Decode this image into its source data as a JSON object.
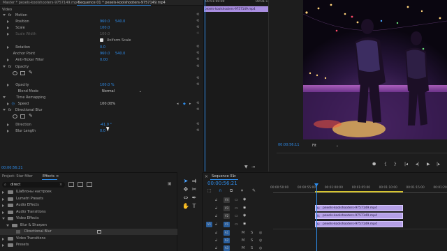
{
  "tabs": {
    "master": "Master * pexels-koolshooters-9757149.mp4",
    "sequence": "Sequence 01 * pexels-koolshooters-9757149.mp4"
  },
  "effect_controls": {
    "section": "Video",
    "motion": "Motion",
    "position_label": "Position",
    "position_x": "960.0",
    "position_y": "540.0",
    "scale_label": "Scale",
    "scale_value": "100.0",
    "scale_width_label": "Scale Width",
    "scale_width_value": "100.0",
    "uniform_scale": "Uniform Scale",
    "rotation_label": "Rotation",
    "rotation_value": "0.0",
    "anchor_label": "Anchor Point",
    "anchor_x": "960.0",
    "anchor_y": "540.0",
    "antiflicker_label": "Anti-flicker Filter",
    "antiflicker_value": "0.00",
    "opacity": "Opacity",
    "opacity_label": "Opacity",
    "opacity_value": "100.0 %",
    "blend_label": "Blend Mode",
    "blend_value": "Normal",
    "time_remap": "Time Remapping",
    "speed_label": "Speed",
    "speed_value": "100.00%",
    "directional_blur": "Directional Blur",
    "direction_label": "Direction",
    "direction_value": "-41.0 °",
    "blur_length_label": "Blur Length",
    "blur_length_value": "0.0",
    "timecode": "00:00:56:21"
  },
  "mini_timeline": {
    "start": "00:01:00:00",
    "end": "00:01:1",
    "clip": "pexels-koolshooters-9757149.mp4"
  },
  "monitor": {
    "timecode": "00:00:56:11",
    "fit": "Fit"
  },
  "project": {
    "tab_project": "Project: Star filter",
    "tab_effects": "Effects",
    "search_value": "direct",
    "items": [
      {
        "label": "Шаблоны настроек",
        "indent": 0
      },
      {
        "label": "Lumetri Presets",
        "indent": 0
      },
      {
        "label": "Audio Effects",
        "indent": 0
      },
      {
        "label": "Audio Transitions",
        "indent": 0
      },
      {
        "label": "Video Effects",
        "indent": 0
      },
      {
        "label": "Blur & Sharpen",
        "indent": 1
      },
      {
        "label": "Directional Blur",
        "indent": 2
      },
      {
        "label": "Video Transitions",
        "indent": 0
      },
      {
        "label": "Presets",
        "indent": 0
      }
    ]
  },
  "timeline": {
    "tab": "Sequence 01",
    "timecode": "00:00:56:21",
    "ruler": [
      "00:00:50:00",
      "00:00:55:00",
      "00:01:00:00",
      "00:01:05:00",
      "00:01:10:00",
      "00:01:15:00",
      "00:01:20:00"
    ],
    "video_tracks": [
      "V4",
      "V3",
      "V2",
      "V1"
    ],
    "audio_tracks": [
      "A1",
      "A2",
      "A3"
    ],
    "source_label": "V1",
    "clips": [
      "pexels-koolshooters-9757149.mp4",
      "pexels-koolshooters-9757149.mp4",
      "pexels-koolshooters-9757149.mp4"
    ]
  }
}
